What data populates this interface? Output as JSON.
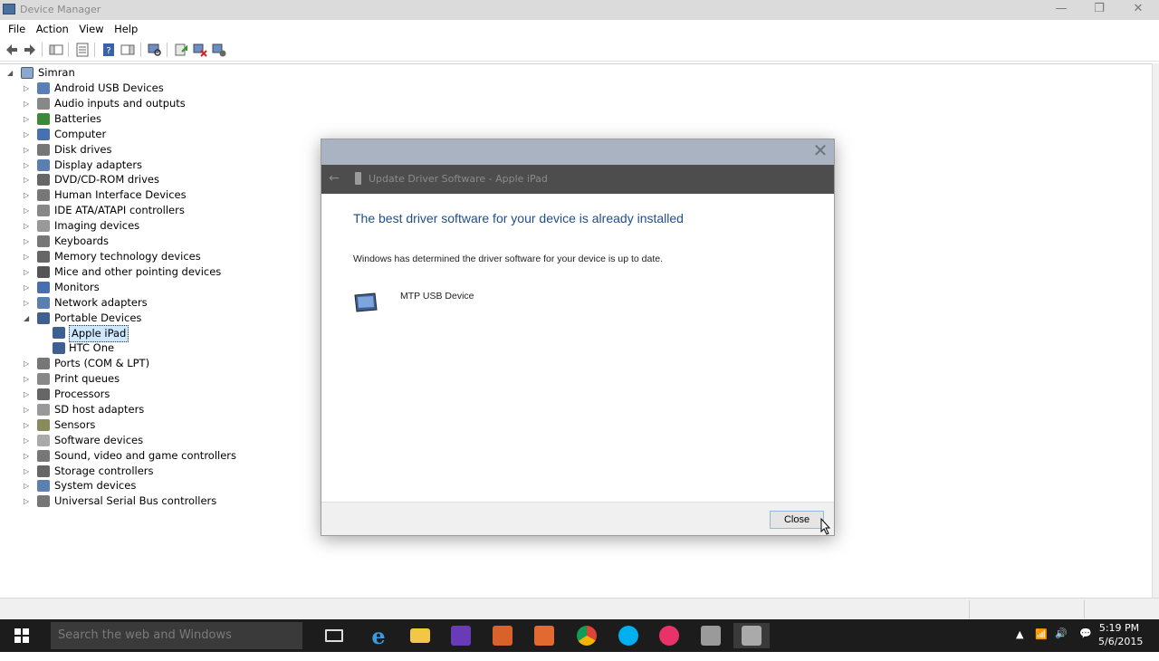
{
  "window": {
    "title": "Device Manager",
    "controls": [
      "minimize",
      "restore",
      "close"
    ]
  },
  "menu": [
    "File",
    "Action",
    "View",
    "Help"
  ],
  "tree": {
    "root": "Simran",
    "items": [
      {
        "label": "Android USB Devices",
        "icon": "usb-phone-icon",
        "expanded": false
      },
      {
        "label": "Audio inputs and outputs",
        "icon": "speaker-icon",
        "expanded": false
      },
      {
        "label": "Batteries",
        "icon": "battery-icon",
        "expanded": false
      },
      {
        "label": "Computer",
        "icon": "computer-icon",
        "expanded": false
      },
      {
        "label": "Disk drives",
        "icon": "disk-icon",
        "expanded": false
      },
      {
        "label": "Display adapters",
        "icon": "display-adapter-icon",
        "expanded": false
      },
      {
        "label": "DVD/CD-ROM drives",
        "icon": "dvd-icon",
        "expanded": false
      },
      {
        "label": "Human Interface Devices",
        "icon": "hid-icon",
        "expanded": false
      },
      {
        "label": "IDE ATA/ATAPI controllers",
        "icon": "ide-icon",
        "expanded": false
      },
      {
        "label": "Imaging devices",
        "icon": "camera-icon",
        "expanded": false
      },
      {
        "label": "Keyboards",
        "icon": "keyboard-icon",
        "expanded": false
      },
      {
        "label": "Memory technology devices",
        "icon": "memory-icon",
        "expanded": false
      },
      {
        "label": "Mice and other pointing devices",
        "icon": "mouse-icon",
        "expanded": false
      },
      {
        "label": "Monitors",
        "icon": "monitor-icon",
        "expanded": false
      },
      {
        "label": "Network adapters",
        "icon": "network-icon",
        "expanded": false
      },
      {
        "label": "Portable Devices",
        "icon": "portable-device-icon",
        "expanded": true
      },
      {
        "label": "Apple iPad",
        "icon": "portable-device-icon",
        "child": true,
        "selected": true
      },
      {
        "label": "HTC One",
        "icon": "portable-device-icon",
        "child": true
      },
      {
        "label": "Ports (COM & LPT)",
        "icon": "port-icon",
        "expanded": false
      },
      {
        "label": "Print queues",
        "icon": "printer-icon",
        "expanded": false
      },
      {
        "label": "Processors",
        "icon": "processor-icon",
        "expanded": false
      },
      {
        "label": "SD host adapters",
        "icon": "sd-icon",
        "expanded": false
      },
      {
        "label": "Sensors",
        "icon": "sensor-icon",
        "expanded": false
      },
      {
        "label": "Software devices",
        "icon": "software-device-icon",
        "expanded": false
      },
      {
        "label": "Sound, video and game controllers",
        "icon": "sound-icon",
        "expanded": false
      },
      {
        "label": "Storage controllers",
        "icon": "storage-icon",
        "expanded": false
      },
      {
        "label": "System devices",
        "icon": "system-icon",
        "expanded": false
      },
      {
        "label": "Universal Serial Bus controllers",
        "icon": "usb-icon",
        "expanded": false
      }
    ]
  },
  "dialog": {
    "header_title": "Update Driver Software - Apple iPad",
    "heading": "The best driver software for your device is already installed",
    "message": "Windows has determined the driver software for your device is up to date.",
    "device_name": "MTP USB Device",
    "close_label": "Close"
  },
  "taskbar": {
    "search_placeholder": "Search the web and Windows",
    "apps": [
      "task-view",
      "internet-explorer",
      "file-explorer",
      "visual-studio",
      "app-orange-1",
      "app-orange-2",
      "chrome",
      "skype",
      "itunes",
      "app-gray-1",
      "app-gray-2"
    ],
    "time": "5:19 PM",
    "date": "5/6/2015"
  },
  "colors": {
    "accent": "#1e4e8c",
    "taskbar": "#1c1c1c",
    "dialog_header": "#4d4d4d"
  }
}
